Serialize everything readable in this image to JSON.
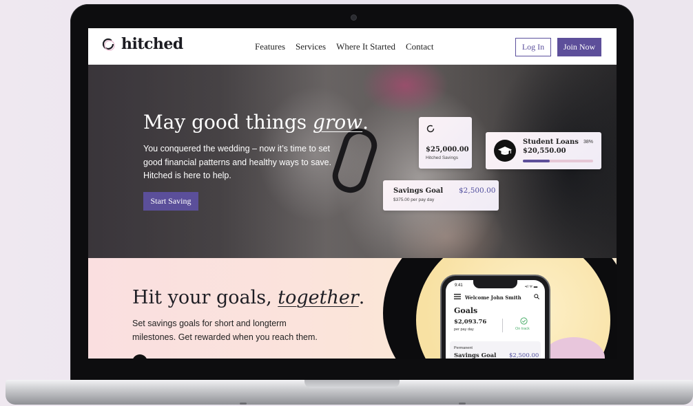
{
  "nav": {
    "brand": "hitched",
    "links": [
      "Features",
      "Services",
      "Where It Started",
      "Contact"
    ],
    "login_label": "Log In",
    "join_label": "Join Now"
  },
  "hero": {
    "title_start": "May good things ",
    "title_emph": "grow",
    "title_end": ".",
    "body": "You conquered the wedding – now it’s time to set good financial patterns and healthy ways to save. Hitched is here to help.",
    "cta_label": "Start Saving"
  },
  "cards": {
    "hitched_savings": {
      "amount": "$25,000.00",
      "label": "Hitched Savings"
    },
    "student_loans": {
      "title": "Student Loans",
      "amount": "$20,550.00",
      "percent": "38%",
      "progress": 0.38
    },
    "savings_goal": {
      "title": "Savings Goal",
      "amount": "$2,500.00",
      "sub": "$375.00 per pay day"
    }
  },
  "goals": {
    "title_start": "Hit your goals, ",
    "title_emph": "together",
    "title_end": ".",
    "body": "Set savings goals for short and longterm milestones. Get rewarded when you reach them."
  },
  "phone": {
    "time": "9:41",
    "status": "•ıl ᯤ ▬",
    "welcome": "Welcome John Smith",
    "heading": "Goals",
    "amount": "$2,093.76",
    "per_pay_day": "per pay day",
    "status_text": "On track",
    "category": "Permanent",
    "goal_title": "Savings Goal",
    "goal_amount": "$2,500.00"
  },
  "colors": {
    "brand_purple": "#5d4f9a",
    "accent_pink": "#e7b9cf",
    "peach": "#fbe3dc"
  }
}
